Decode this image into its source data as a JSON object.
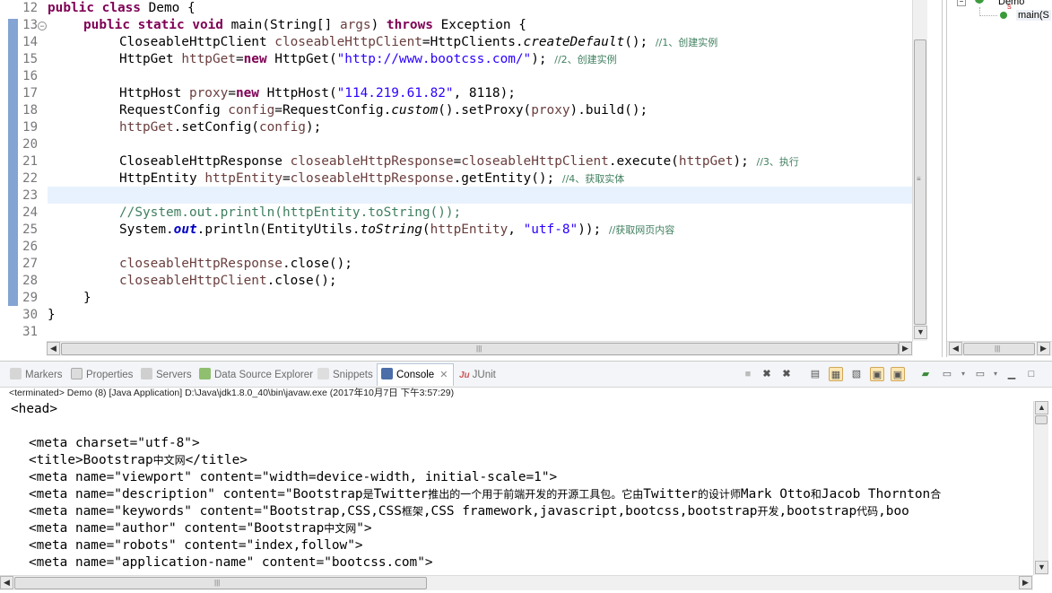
{
  "editor": {
    "line_numbers": [
      "12",
      "13",
      "14",
      "15",
      "16",
      "17",
      "18",
      "19",
      "20",
      "21",
      "22",
      "23",
      "24",
      "25",
      "26",
      "27",
      "28",
      "29",
      "30",
      "31"
    ],
    "code": {
      "l12": {
        "kw1": "public",
        "kw2": "class",
        "rest": " Demo {"
      },
      "l13": {
        "kw1": "public",
        "kw2": "static",
        "kw3": "void",
        "rest1": " main(String[] ",
        "var": "args",
        "rest2": ") ",
        "kw4": "throws",
        "rest3": " Exception {"
      },
      "l14": {
        "a": "CloseableHttpClient ",
        "var": "closeableHttpClient",
        "b": "=HttpClients.",
        "it": "createDefault",
        "c": "(); ",
        "cm": "//1、创建实例"
      },
      "l15": {
        "a": "HttpGet ",
        "var": "httpGet",
        "b": "=",
        "kw": "new",
        "c": " HttpGet(",
        "str": "\"http://www.bootcss.com/\"",
        "d": "); ",
        "cm": "//2、创建实例"
      },
      "l17": {
        "a": "HttpHost ",
        "var": "proxy",
        "b": "=",
        "kw": "new",
        "c": " HttpHost(",
        "str": "\"114.219.61.82\"",
        "d": ", 8118);"
      },
      "l18": {
        "a": "RequestConfig ",
        "var": "config",
        "b": "=RequestConfig.",
        "it": "custom",
        "c": "().setProxy(",
        "var2": "proxy",
        "d": ").build();"
      },
      "l19": {
        "var": "httpGet",
        "a": ".setConfig(",
        "var2": "config",
        "b": ");"
      },
      "l21": {
        "a": "CloseableHttpResponse ",
        "var": "closeableHttpResponse",
        "b": "=",
        "var2": "closeableHttpClient",
        "c": ".execute(",
        "var3": "httpGet",
        "d": "); ",
        "cm": "//3、执行"
      },
      "l22": {
        "a": "HttpEntity ",
        "var": "httpEntity",
        "b": "=",
        "var2": "closeableHttpResponse",
        "c": ".getEntity(); ",
        "cm": "//4、获取实体"
      },
      "l24": {
        "cm": "//System.out.println(httpEntity.toString());"
      },
      "l25": {
        "a": "System.",
        "sf": "out",
        "b": ".println(EntityUtils.",
        "it": "toString",
        "c": "(",
        "var": "httpEntity",
        "d": ", ",
        "str": "\"utf-8\"",
        "e": ")); ",
        "cm": "//获取网页内容"
      },
      "l27": {
        "var": "closeableHttpResponse",
        "a": ".close();"
      },
      "l28": {
        "var": "closeableHttpClient",
        "a": ".close();"
      },
      "l29": {
        "a": "}"
      },
      "l30": {
        "a": "}"
      }
    }
  },
  "outline": {
    "class_label": "Demo",
    "method_label": "main(S",
    "modifier": "S"
  },
  "views": {
    "tabs": [
      {
        "label": "Markers",
        "icon": "markers-icon"
      },
      {
        "label": "Properties",
        "icon": "properties-icon"
      },
      {
        "label": "Servers",
        "icon": "servers-icon"
      },
      {
        "label": "Data Source Explorer",
        "icon": "database-icon"
      },
      {
        "label": "Snippets",
        "icon": "snippets-icon"
      },
      {
        "label": "Console",
        "icon": "console-icon",
        "active": true
      },
      {
        "label": "JUnit",
        "icon": "junit-icon"
      }
    ],
    "junit_prefix": "Ju",
    "tab_close": "✕"
  },
  "console": {
    "status": "<terminated> Demo (8) [Java Application] D:\\Java\\jdk1.8.0_40\\bin\\javaw.exe (2017年10月7日 下午3:57:29)",
    "lines": [
      {
        "text": "<head>",
        "indent": 0
      },
      {
        "text": "",
        "indent": 0
      },
      {
        "text": "<meta charset=\"utf-8\">",
        "indent": 2
      },
      {
        "pre": "<title>Bootstrap",
        "zh": "中文网",
        "post": "</title>",
        "indent": 2
      },
      {
        "text": "<meta name=\"viewport\" content=\"width=device-width, initial-scale=1\">",
        "indent": 2
      },
      {
        "pre": "<meta name=\"description\" content=\"Bootstrap",
        "zh": "是",
        "mid": "Twitter",
        "zh2": "推出的一个用于前端开发的开源工具包。它由",
        "post": "Twitter",
        "zh3": "的设计师",
        "post2": "Mark Otto",
        "zh4": "和",
        "post3": "Jacob Thornton",
        "zh5": "合",
        "indent": 2
      },
      {
        "pre": "<meta name=\"keywords\" content=\"Bootstrap,CSS,CSS",
        "zh": "框架",
        "mid": ",CSS framework,javascript,bootcss,bootstrap",
        "zh2": "开发",
        "post": ",bootstrap",
        "zh3": "代码",
        "post2": ",boo",
        "indent": 2
      },
      {
        "pre": "<meta name=\"author\" content=\"Bootstrap",
        "zh": "中文网",
        "post": "\">",
        "indent": 2
      },
      {
        "text": "<meta name=\"robots\" content=\"index,follow\">",
        "indent": 2
      },
      {
        "text": "<meta name=\"application-name\" content=\"bootcss.com\">",
        "indent": 2
      }
    ]
  },
  "colors": {
    "keyword": "#7f0055",
    "string": "#2a00ff",
    "comment": "#3f7f5f",
    "variable": "#6a3e3e",
    "current_line": "#e8f2fe",
    "static_field": "#0000c0"
  }
}
